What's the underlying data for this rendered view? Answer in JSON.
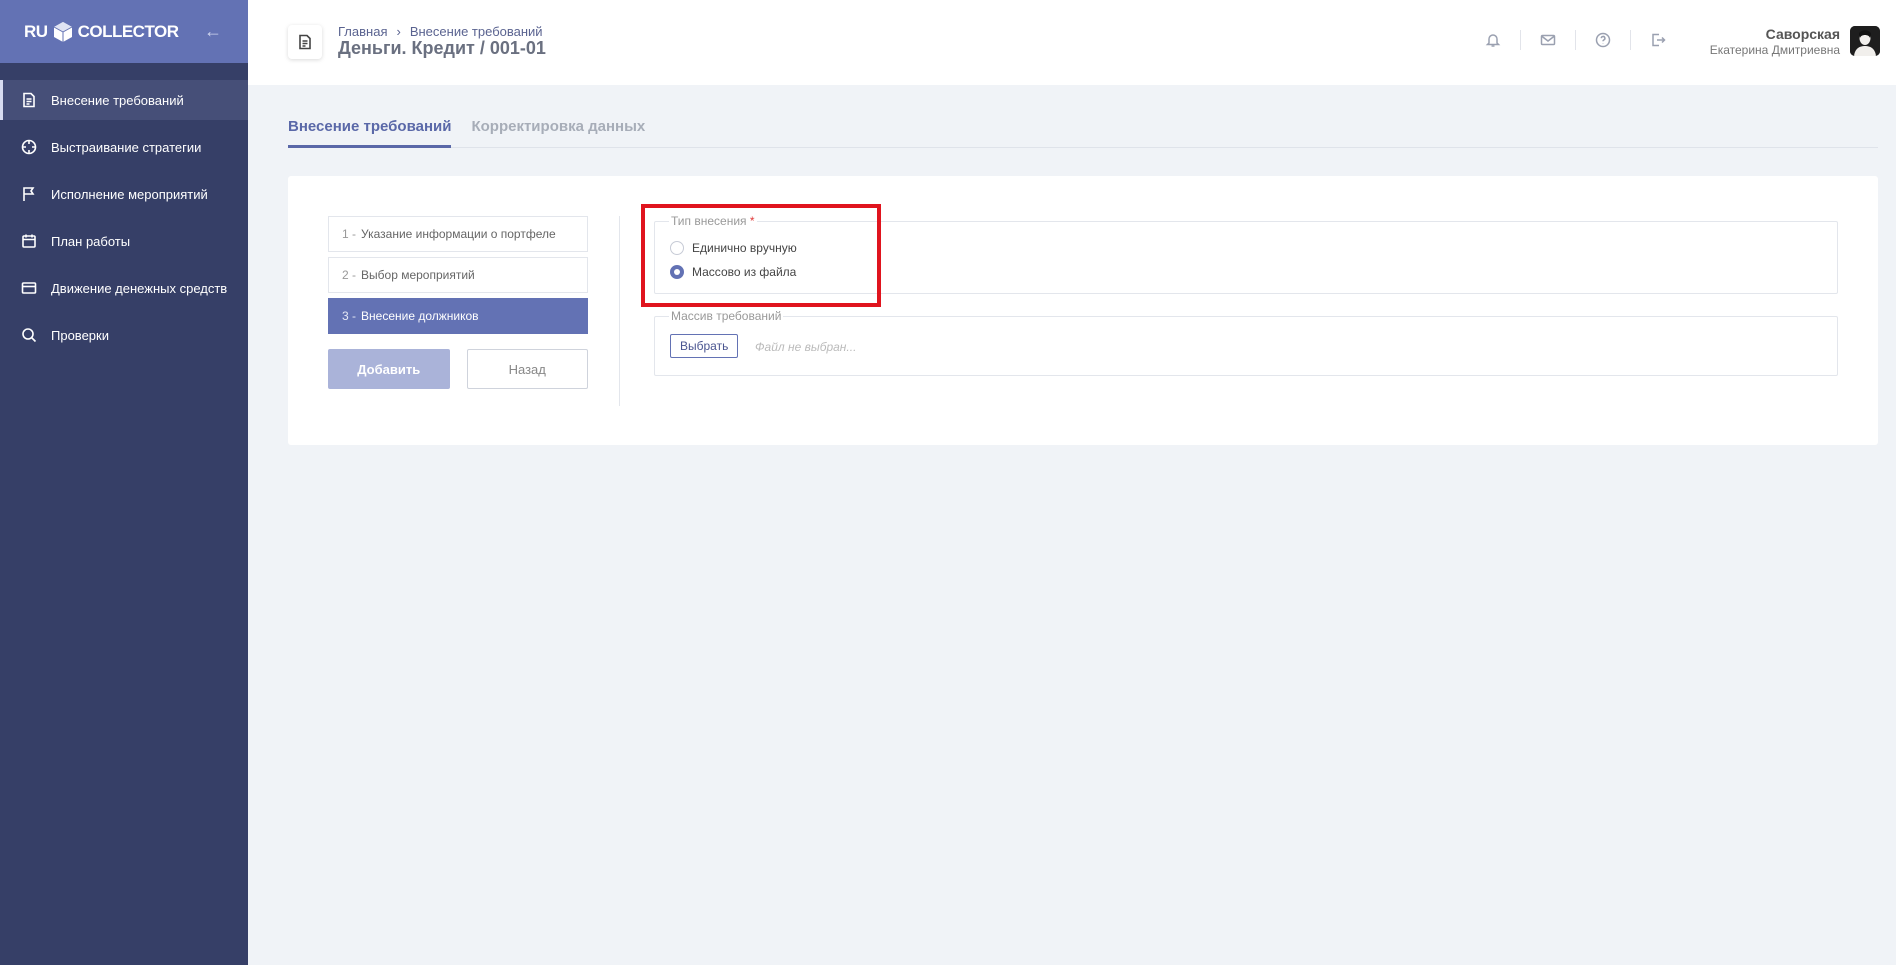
{
  "sidebar": {
    "logo_left": "RU",
    "logo_right": "COLLECTOR",
    "items": [
      {
        "label": "Внесение требований",
        "icon": "document-icon"
      },
      {
        "label": "Выстраивание стратегии",
        "icon": "crosshair-icon"
      },
      {
        "label": "Исполнение мероприятий",
        "icon": "flag-icon"
      },
      {
        "label": "План работы",
        "icon": "calendar-icon"
      },
      {
        "label": "Движение денежных средств",
        "icon": "credit-card-icon"
      },
      {
        "label": "Проверки",
        "icon": "search-icon"
      }
    ]
  },
  "header": {
    "breadcrumb": [
      "Главная",
      "Внесение требований"
    ],
    "title": "Деньги. Кредит / 001-01",
    "icons": [
      "bell-icon",
      "mail-icon",
      "help-icon",
      "logout-icon"
    ],
    "user": {
      "last_name": "Саворская",
      "first_name": "Екатерина Дмитриевна"
    }
  },
  "tabs": [
    {
      "label": "Внесение требований",
      "active": true
    },
    {
      "label": "Корректировка данных",
      "active": false
    }
  ],
  "steps": [
    {
      "num": "1 -",
      "label": "Указание информации о портфеле",
      "active": false
    },
    {
      "num": "2 -",
      "label": "Выбор мероприятий",
      "active": false
    },
    {
      "num": "3 -",
      "label": "Внесение должников",
      "active": true
    }
  ],
  "buttons": {
    "add": "Добавить",
    "back": "Назад"
  },
  "entry_type": {
    "legend": "Тип внесения",
    "required_mark": "*",
    "options": [
      {
        "label": "Единично вручную",
        "selected": false
      },
      {
        "label": "Массово из файла",
        "selected": true
      }
    ]
  },
  "requirements_array": {
    "legend": "Массив требований",
    "choose_button": "Выбрать",
    "file_placeholder": "Файл не выбран..."
  },
  "colors": {
    "sidebar": "#363f67",
    "accent": "#6372b4",
    "highlight": "#e0141e"
  }
}
